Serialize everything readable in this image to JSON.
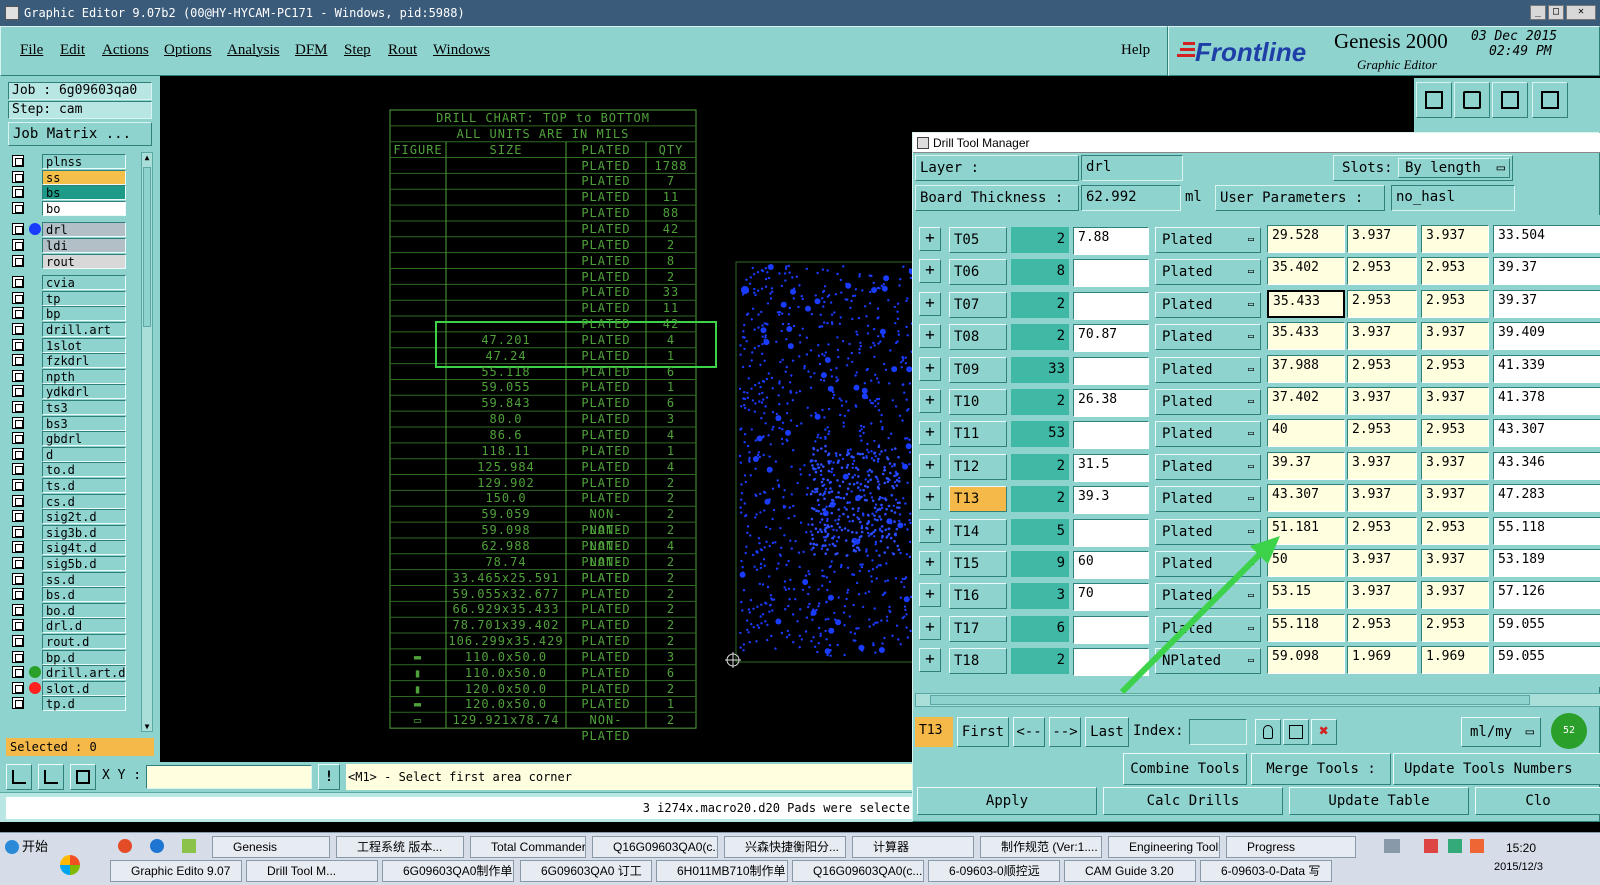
{
  "window": {
    "title": "Graphic Editor 9.07b2 (00@HY-HYCAM-PC171 - Windows, pid:5988)"
  },
  "menu": {
    "items": [
      "File",
      "Edit",
      "Actions",
      "Options",
      "Analysis",
      "DFM",
      "Step",
      "Rout",
      "Windows"
    ],
    "help": "Help"
  },
  "brand": {
    "company": "Frontline",
    "product": "Genesis 2000",
    "sub": "Graphic Editor",
    "date": "03 Dec 2015",
    "time": "02:49 PM"
  },
  "job": {
    "name": "Job : 6g09603qa0",
    "step": "Step: cam",
    "matrix_button": "Job Matrix ...",
    "selected": "Selected : 0"
  },
  "layers": [
    {
      "name": "plnss",
      "color": "#8fd3cf",
      "mark": ""
    },
    {
      "name": "ss",
      "color": "#f5c04a",
      "mark": "✎"
    },
    {
      "name": "bs",
      "color": "#1e9a88",
      "mark": ""
    },
    {
      "name": "bo",
      "color": "#ffffff",
      "mark": "✎"
    },
    {
      "name": "drl",
      "color": "#b3bfc7",
      "dot": "#1a3cff",
      "mark": ""
    },
    {
      "name": "ldi",
      "color": "#b3bfc7",
      "mark": ""
    },
    {
      "name": "rout",
      "color": "#d8d8d8",
      "mark": ""
    },
    {
      "name": "cvia",
      "color": "#8fd3cf",
      "mark": ""
    },
    {
      "name": "tp",
      "color": "#8fd3cf",
      "mark": ""
    },
    {
      "name": "bp",
      "color": "#8fd3cf",
      "mark": ""
    },
    {
      "name": "drill.art",
      "color": "#8fd3cf",
      "mark": ""
    },
    {
      "name": "1slot",
      "color": "#8fd3cf",
      "mark": ""
    },
    {
      "name": "fzkdrl",
      "color": "#8fd3cf",
      "mark": ""
    },
    {
      "name": "npth",
      "color": "#8fd3cf",
      "mark": ""
    },
    {
      "name": "ydkdrl",
      "color": "#8fd3cf",
      "mark": ""
    },
    {
      "name": "ts3",
      "color": "#8fd3cf",
      "mark": ""
    },
    {
      "name": "bs3",
      "color": "#8fd3cf",
      "mark": ""
    },
    {
      "name": "gbdrl",
      "color": "#8fd3cf",
      "mark": ""
    },
    {
      "name": "d",
      "color": "#8fd3cf",
      "mark": ""
    },
    {
      "name": "to.d",
      "color": "#8fd3cf",
      "mark": "✎"
    },
    {
      "name": "ts.d",
      "color": "#8fd3cf",
      "mark": ""
    },
    {
      "name": "cs.d",
      "color": "#8fd3cf",
      "mark": ""
    },
    {
      "name": "sig2t.d",
      "color": "#8fd3cf",
      "mark": "✎"
    },
    {
      "name": "sig3b.d",
      "color": "#8fd3cf",
      "mark": "✎"
    },
    {
      "name": "sig4t.d",
      "color": "#8fd3cf",
      "mark": "✎"
    },
    {
      "name": "sig5b.d",
      "color": "#8fd3cf",
      "mark": "✎"
    },
    {
      "name": "ss.d",
      "color": "#8fd3cf",
      "mark": "✎"
    },
    {
      "name": "bs.d",
      "color": "#8fd3cf",
      "mark": ""
    },
    {
      "name": "bo.d",
      "color": "#8fd3cf",
      "mark": "✎"
    },
    {
      "name": "drl.d",
      "color": "#8fd3cf",
      "mark": ""
    },
    {
      "name": "rout.d",
      "color": "#8fd3cf",
      "mark": ""
    },
    {
      "name": "bp.d",
      "color": "#8fd3cf",
      "mark": ""
    },
    {
      "name": "drill.art.d",
      "color": "#8fd3cf",
      "dot": "#2aa02a",
      "mark": "✎"
    },
    {
      "name": "slot.d",
      "color": "#8fd3cf",
      "dot": "#ff2020",
      "mark": ""
    },
    {
      "name": "tp.d",
      "color": "#8fd3cf",
      "mark": ""
    }
  ],
  "drill_chart": {
    "title1": "DRILL CHART: TOP to BOTTOM",
    "title2": "ALL UNITS ARE IN MILS",
    "headers": [
      "FIGURE",
      "SIZE",
      "PLATED",
      "QTY"
    ],
    "rows": [
      [
        "",
        "",
        "PLATED",
        "1788"
      ],
      [
        "",
        "",
        "PLATED",
        "7"
      ],
      [
        "",
        "",
        "PLATED",
        "11"
      ],
      [
        "",
        "",
        "PLATED",
        "88"
      ],
      [
        "",
        "",
        "PLATED",
        "42"
      ],
      [
        "",
        "",
        "PLATED",
        "2"
      ],
      [
        "",
        "",
        "PLATED",
        "8"
      ],
      [
        "",
        "",
        "PLATED",
        "2"
      ],
      [
        "",
        "",
        "PLATED",
        "33"
      ],
      [
        "",
        "",
        "PLATED",
        "11"
      ],
      [
        "",
        "",
        "PLATED",
        "42"
      ],
      [
        "",
        "47.201",
        "PLATED",
        "4"
      ],
      [
        "",
        "47.24",
        "PLATED",
        "1"
      ],
      [
        "",
        "55.118",
        "PLATED",
        "6"
      ],
      [
        "",
        "59.055",
        "PLATED",
        "1"
      ],
      [
        "",
        "59.843",
        "PLATED",
        "6"
      ],
      [
        "",
        "80.0",
        "PLATED",
        "3"
      ],
      [
        "",
        "86.6",
        "PLATED",
        "4"
      ],
      [
        "",
        "118.11",
        "PLATED",
        "1"
      ],
      [
        "",
        "125.984",
        "PLATED",
        "4"
      ],
      [
        "",
        "129.902",
        "PLATED",
        "2"
      ],
      [
        "",
        "150.0",
        "PLATED",
        "2"
      ],
      [
        "",
        "59.059",
        "NON-PLATED",
        "2"
      ],
      [
        "",
        "59.098",
        "NON-PLATED",
        "2"
      ],
      [
        "",
        "62.988",
        "NON-PLATED",
        "4"
      ],
      [
        "",
        "78.74",
        "NON-PLATED",
        "2"
      ],
      [
        "",
        "33.465x25.591",
        "PLATED",
        "2"
      ],
      [
        "",
        "59.055x32.677",
        "PLATED",
        "2"
      ],
      [
        "",
        "66.929x35.433",
        "PLATED",
        "2"
      ],
      [
        "",
        "78.701x39.402",
        "PLATED",
        "2"
      ],
      [
        "",
        "106.299x35.429",
        "PLATED",
        "2"
      ],
      [
        "▬",
        "110.0x50.0",
        "PLATED",
        "3"
      ],
      [
        "▮",
        "110.0x50.0",
        "PLATED",
        "6"
      ],
      [
        "▮",
        "120.0x50.0",
        "PLATED",
        "2"
      ],
      [
        "▬",
        "120.0x50.0",
        "PLATED",
        "1"
      ],
      [
        "▭",
        "129.921x78.74",
        "NON-PLATED",
        "2"
      ]
    ]
  },
  "dtm": {
    "title": "Drill Tool Manager",
    "layer_label": "Layer :",
    "layer_value": "drl",
    "slots_label": "Slots:",
    "slots_value": "By length",
    "board_label": "Board Thickness :",
    "board_value": "62.992",
    "board_unit": "ml",
    "user_params_label": "User Parameters :",
    "user_params_value": "no_hasl",
    "tools": [
      {
        "tool": "T05",
        "count": "2",
        "finish": "7.88",
        "type": "Plated",
        "drill": "29.528",
        "p1": "3.937",
        "p2": "3.937",
        "size": "33.504"
      },
      {
        "tool": "T06",
        "count": "8",
        "finish": "",
        "type": "Plated",
        "drill": "35.402",
        "p1": "2.953",
        "p2": "2.953",
        "size": "39.37"
      },
      {
        "tool": "T07",
        "count": "2",
        "finish": "",
        "type": "Plated",
        "drill": "35.433",
        "p1": "2.953",
        "p2": "2.953",
        "size": "39.37"
      },
      {
        "tool": "T08",
        "count": "2",
        "finish": "70.87",
        "type": "Plated",
        "drill": "35.433",
        "p1": "3.937",
        "p2": "3.937",
        "size": "39.409"
      },
      {
        "tool": "T09",
        "count": "33",
        "finish": "",
        "type": "Plated",
        "drill": "37.988",
        "p1": "2.953",
        "p2": "2.953",
        "size": "41.339"
      },
      {
        "tool": "T10",
        "count": "2",
        "finish": "26.38",
        "type": "Plated",
        "drill": "37.402",
        "p1": "3.937",
        "p2": "3.937",
        "size": "41.378"
      },
      {
        "tool": "T11",
        "count": "53",
        "finish": "",
        "type": "Plated",
        "drill": "40",
        "p1": "2.953",
        "p2": "2.953",
        "size": "43.307"
      },
      {
        "tool": "T12",
        "count": "2",
        "finish": "31.5",
        "type": "Plated",
        "drill": "39.37",
        "p1": "3.937",
        "p2": "3.937",
        "size": "43.346"
      },
      {
        "tool": "T13",
        "count": "2",
        "finish": "39.3",
        "type": "Plated",
        "drill": "43.307",
        "p1": "3.937",
        "p2": "3.937",
        "size": "47.283"
      },
      {
        "tool": "T14",
        "count": "5",
        "finish": "",
        "type": "Plated",
        "drill": "51.181",
        "p1": "2.953",
        "p2": "2.953",
        "size": "55.118"
      },
      {
        "tool": "T15",
        "count": "9",
        "finish": "60",
        "type": "Plated",
        "drill": "50",
        "p1": "3.937",
        "p2": "3.937",
        "size": "53.189"
      },
      {
        "tool": "T16",
        "count": "3",
        "finish": "70",
        "type": "Plated",
        "drill": "53.15",
        "p1": "3.937",
        "p2": "3.937",
        "size": "57.126"
      },
      {
        "tool": "T17",
        "count": "6",
        "finish": "",
        "type": "Plated",
        "drill": "55.118",
        "p1": "2.953",
        "p2": "2.953",
        "size": "59.055"
      },
      {
        "tool": "T18",
        "count": "2",
        "finish": "",
        "type": "NPlated",
        "drill": "59.098",
        "p1": "1.969",
        "p2": "1.969",
        "size": "59.055"
      }
    ],
    "current": "T13",
    "nav": {
      "first": "First",
      "prev": "<--",
      "next": "-->",
      "last": "Last",
      "index": "Index:",
      "units": "ml/my"
    },
    "combine": "Combine Tools",
    "merge": "Merge Tools :",
    "update_numbers": "Update Tools Numbers",
    "apply": "Apply",
    "calc": "Calc Drills",
    "update_table": "Update Table",
    "close": "Clo"
  },
  "bottom": {
    "xy_label": "X Y :",
    "prompt": "<M1> - Select first area corner",
    "status": "3 i274x.macro20.d20 Pads were selecte"
  },
  "taskbar": {
    "start": "开始",
    "tasks": [
      "Genesis",
      "工程系统  版本...",
      "Total Commander ...",
      "Q16G09603QA0(c...",
      "兴森快捷衡阳分...",
      "计算器",
      "制作规范 (Ver:1....",
      "Engineering Toolki...",
      "Progress"
    ],
    "tasks2": [
      "Graphic Edito 9.07",
      "Drill Tool M...",
      "6G09603QA0制作单",
      "6G09603QA0 订工",
      "6H011MB710制作单",
      "Q16G09603QA0(c...",
      "6-09603-0顺控远",
      "CAM Guide 3.20",
      "6-09603-0-Data 写"
    ],
    "clock": "15:20",
    "date": "2015/12/3"
  },
  "colors": {
    "panel": "#8fd3cf",
    "cad_green": "#4fa23a",
    "pads_blue": "#1a3cff",
    "highlight": "#3cd24a",
    "current_tool": "#f5b94a"
  }
}
